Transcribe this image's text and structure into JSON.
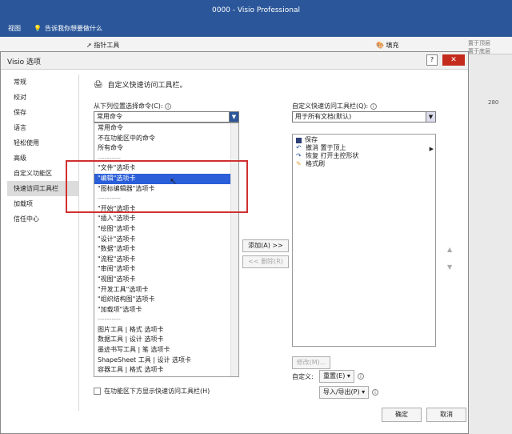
{
  "window_title": "0000  -  Visio Professional",
  "ribbon": {
    "tab_view": "视图",
    "tell_me": "告诉我你想要做什么",
    "pointer_tool": "指针工具",
    "fill": "填充",
    "bring_to_front": "置于顶层",
    "send_to_back": "置于底层",
    "ruler": "280"
  },
  "dialog": {
    "title": "Visio 选项",
    "help": "?",
    "close": "✕",
    "nav": [
      "常规",
      "校对",
      "保存",
      "语言",
      "轻松使用",
      "高级",
      "自定义功能区",
      "快速访问工具栏",
      "加载项",
      "信任中心"
    ],
    "nav_selected_index": 7,
    "section_title": "自定义快速访问工具栏。",
    "choose_label": "从下列位置选择命令(C):",
    "choose_value": "常用命令",
    "command_list": [
      "常用命令",
      "不在功能区中的命令",
      "所有命令",
      "----------",
      "\"文件\"选项卡",
      "\"编辑\"选项卡",
      "\"图标编辑器\"选项卡",
      "----------",
      "\"开始\"选项卡",
      "\"插入\"选项卡",
      "\"绘图\"选项卡",
      "\"设计\"选项卡",
      "\"数据\"选项卡",
      "\"流程\"选项卡",
      "\"审阅\"选项卡",
      "\"视图\"选项卡",
      "\"开发工具\"选项卡",
      "\"组织结构图\"选项卡",
      "\"加载项\"选项卡",
      "----------",
      "图片工具 | 格式 选项卡",
      "数据工具 | 设计 选项卡",
      "墨迹书写工具 | 笔 选项卡",
      "ShapeSheet 工具 | 设计 选项卡",
      "容器工具 | 格式 选项卡"
    ],
    "command_selected_index": 5,
    "qat_label": "自定义快速访问工具栏(Q):",
    "qat_value": "用于所有文档(默认)",
    "qat_items": [
      "保存",
      "撤消 置于顶上",
      "恢复 打开主控形状",
      "格式刷"
    ],
    "add_button": "添加(A) >>",
    "remove_button": "<< 删除(R)",
    "modify_button": "修改(M)...",
    "customize_label": "自定义:",
    "reset_button": "重置(E) ▾",
    "import_export_button": "导入/导出(P) ▾",
    "show_below_label": "在功能区下方显示快速访问工具栏(H)",
    "ok_button": "确定",
    "cancel_button": "取消"
  }
}
